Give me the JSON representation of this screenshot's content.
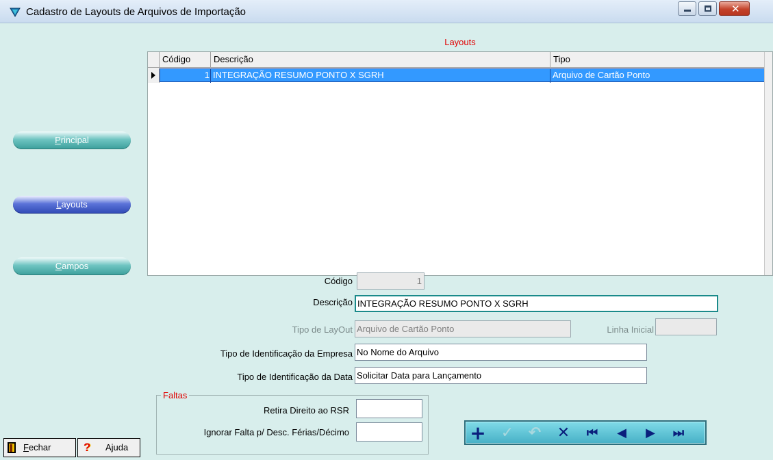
{
  "window": {
    "title": "Cadastro de Layouts de Arquivos de Importação"
  },
  "sidebar": {
    "principal": {
      "pre": "",
      "key": "P",
      "post": "rincipal"
    },
    "layouts": {
      "pre": "",
      "key": "L",
      "post": "ayouts"
    },
    "campos": {
      "pre": "",
      "key": "C",
      "post": "ampos"
    },
    "fechar": {
      "key": "F",
      "post": "echar"
    },
    "ajuda": "Ajuda"
  },
  "grid": {
    "title": "Layouts",
    "headers": {
      "codigo": "Código",
      "descricao": "Descrição",
      "tipo": "Tipo"
    },
    "rows": [
      {
        "codigo": "1",
        "descricao": "INTEGRAÇÃO RESUMO PONTO X SGRH",
        "tipo": "Arquivo de Cartão Ponto"
      }
    ]
  },
  "form": {
    "codigo_label": "Código",
    "codigo_value": "1",
    "descricao_label": "Descrição",
    "descricao_value": "INTEGRAÇÃO RESUMO PONTO X SGRH",
    "tipo_layout_label": "Tipo de LayOut",
    "tipo_layout_value": "Arquivo de Cartão Ponto",
    "linha_inicial_label": "Linha Inicial",
    "linha_inicial_value": "",
    "tipo_id_empresa_label": "Tipo de Identificação da Empresa",
    "tipo_id_empresa_value": "No Nome do Arquivo",
    "tipo_id_data_label": "Tipo de Identificação da Data",
    "tipo_id_data_value": "Solicitar Data para Lançamento"
  },
  "faltas": {
    "title": "Faltas",
    "retira_label": "Retira Direito ao RSR",
    "retira_value": "",
    "ignorar_label": "Ignorar Falta p/ Desc. Férias/Décimo",
    "ignorar_value": ""
  },
  "navigator": {
    "icons": [
      "plus-icon",
      "check-icon",
      "undo-icon",
      "x-icon",
      "first-icon",
      "prior-icon",
      "next-icon",
      "last-icon"
    ],
    "glyphs": {
      "add": "+",
      "post": "✓",
      "cancel": "↶",
      "delete": "✕",
      "first": "⏮",
      "prior": "◀",
      "next": "▶",
      "last": "⏭"
    }
  },
  "colors": {
    "accent_red": "#e00000",
    "selection": "#3399ff",
    "panel": "#d8eeec"
  }
}
